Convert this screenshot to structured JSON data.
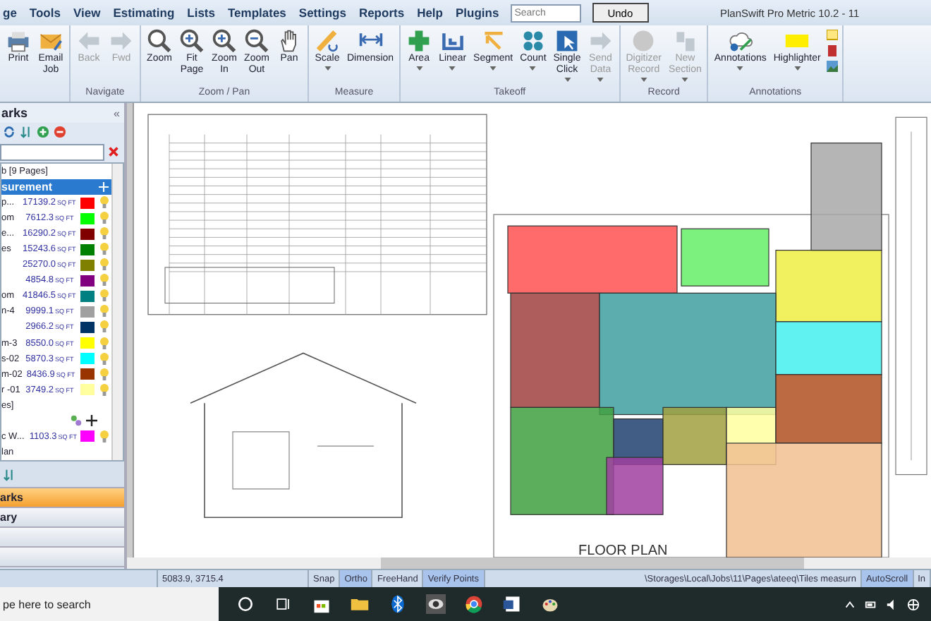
{
  "menu": [
    "ge",
    "Tools",
    "View",
    "Estimating",
    "Lists",
    "Templates",
    "Settings",
    "Reports",
    "Help",
    "Plugins"
  ],
  "search": {
    "placeholder": "Search"
  },
  "undo": "Undo",
  "title": "PlanSwift Pro Metric 10.2 - 11",
  "ribbon": [
    {
      "buttons": [
        {
          "lines": [
            "Print"
          ],
          "disabled": false,
          "dropdown": false
        },
        {
          "lines": [
            "Email",
            "Job"
          ],
          "disabled": false,
          "dropdown": false
        }
      ]
    },
    {
      "label": "Navigate",
      "buttons": [
        {
          "lines": [
            "Back"
          ],
          "disabled": true,
          "dropdown": false
        },
        {
          "lines": [
            "Fwd"
          ],
          "disabled": true,
          "dropdown": false
        }
      ]
    },
    {
      "label": "Zoom / Pan",
      "buttons": [
        {
          "lines": [
            "Zoom"
          ],
          "disabled": false,
          "dropdown": false
        },
        {
          "lines": [
            "Fit",
            "Page"
          ],
          "disabled": false,
          "dropdown": false
        },
        {
          "lines": [
            "Zoom",
            "In"
          ],
          "disabled": false,
          "dropdown": false
        },
        {
          "lines": [
            "Zoom",
            "Out"
          ],
          "disabled": false,
          "dropdown": false
        },
        {
          "lines": [
            "Pan"
          ],
          "disabled": false,
          "dropdown": false
        }
      ]
    },
    {
      "label": "Measure",
      "buttons": [
        {
          "lines": [
            "Scale"
          ],
          "disabled": false,
          "dropdown": true
        },
        {
          "lines": [
            "Dimension"
          ],
          "disabled": false,
          "dropdown": false
        }
      ]
    },
    {
      "label": "Takeoff",
      "buttons": [
        {
          "lines": [
            "Area"
          ],
          "disabled": false,
          "dropdown": true
        },
        {
          "lines": [
            "Linear"
          ],
          "disabled": false,
          "dropdown": true
        },
        {
          "lines": [
            "Segment"
          ],
          "disabled": false,
          "dropdown": true
        },
        {
          "lines": [
            "Count"
          ],
          "disabled": false,
          "dropdown": true
        },
        {
          "lines": [
            "Single",
            "Click"
          ],
          "disabled": false,
          "dropdown": true
        },
        {
          "lines": [
            "Send",
            "Data"
          ],
          "disabled": true,
          "dropdown": true
        }
      ]
    },
    {
      "label": "Record",
      "buttons": [
        {
          "lines": [
            "Digitizer",
            "Record"
          ],
          "disabled": true,
          "dropdown": true
        },
        {
          "lines": [
            "New",
            "Section"
          ],
          "disabled": true,
          "dropdown": true
        }
      ]
    },
    {
      "label": "Annotations",
      "buttons": [
        {
          "lines": [
            "Annotations"
          ],
          "disabled": false,
          "dropdown": true
        },
        {
          "lines": [
            "Highlighter"
          ],
          "disabled": false,
          "dropdown": true
        }
      ]
    }
  ],
  "panel": {
    "title": "arks",
    "collapse": "«",
    "job": "b [9 Pages]",
    "group": "surement",
    "rows": [
      {
        "kind": "item",
        "name": "p...",
        "value": "17139.2",
        "unit": "SQ FT",
        "color": "#ff0000"
      },
      {
        "kind": "item",
        "name": "om",
        "value": "7612.3",
        "unit": "SQ FT",
        "color": "#00ff00"
      },
      {
        "kind": "item",
        "name": "e...",
        "value": "16290.2",
        "unit": "SQ FT",
        "color": "#800000"
      },
      {
        "kind": "item",
        "name": "es",
        "value": "15243.6",
        "unit": "SQ FT",
        "color": "#008000"
      },
      {
        "kind": "item",
        "value": "25270.0",
        "unit": "SQ FT",
        "color": "#808000"
      },
      {
        "kind": "item",
        "value": "4854.8",
        "unit": "SQ FT",
        "color": "#800080"
      },
      {
        "kind": "item",
        "name": "om",
        "value": "41846.5",
        "unit": "SQ FT",
        "color": "#008080"
      },
      {
        "kind": "item",
        "name": "n-4",
        "value": "9999.1",
        "unit": "SQ FT",
        "color": "#a0a0a0"
      },
      {
        "kind": "item",
        "value": "2966.2",
        "unit": "SQ FT",
        "color": "#003366"
      },
      {
        "kind": "item",
        "name": "m-3",
        "value": "8550.0",
        "unit": "SQ FT",
        "color": "#ffff00"
      },
      {
        "kind": "item",
        "name": "s-02",
        "value": "5870.3",
        "unit": "SQ FT",
        "color": "#00ffff"
      },
      {
        "kind": "item",
        "name": "m-02",
        "value": "8436.9",
        "unit": "SQ FT",
        "color": "#993300"
      },
      {
        "kind": "item",
        "name": "r -01",
        "value": "3749.2",
        "unit": "SQ FT",
        "color": "#ffffa0"
      },
      {
        "kind": "label",
        "name": "es]"
      },
      {
        "kind": "tools"
      },
      {
        "kind": "item",
        "name": "c W...",
        "value": "1103.3",
        "unit": "SQ FT",
        "color": "#ff00ff"
      },
      {
        "kind": "label",
        "name": "lan"
      }
    ],
    "sections": [
      {
        "label": "arks",
        "selected": true
      },
      {
        "label": "ary",
        "selected": false
      }
    ]
  },
  "drawing": {
    "caption": "FLOOR PLAN"
  },
  "status": [
    {
      "kind": "text",
      "text": "5083.9, 3715.4"
    },
    {
      "kind": "toggle",
      "text": "Snap",
      "on": false
    },
    {
      "kind": "toggle",
      "text": "Ortho",
      "on": true
    },
    {
      "kind": "toggle",
      "text": "FreeHand",
      "on": false
    },
    {
      "kind": "toggle",
      "text": "Verify Points",
      "on": true
    },
    {
      "kind": "path",
      "text": "\\Storages\\Local\\Jobs\\11\\Pages\\ateeq\\Tiles measurn"
    },
    {
      "kind": "toggle",
      "text": "AutoScroll",
      "on": true
    },
    {
      "kind": "text",
      "text": "In"
    }
  ],
  "taskbar": {
    "search": "pe here to search"
  }
}
